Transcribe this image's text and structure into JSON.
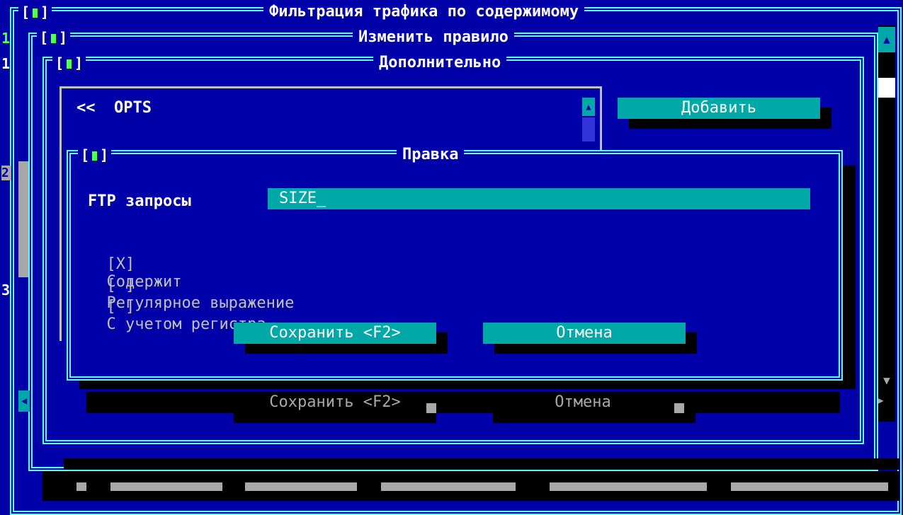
{
  "window_main": {
    "title": "Фильтрация трафика по содержимому"
  },
  "window_edit_rule": {
    "title": "Изменить правило",
    "line_numbers": [
      "1",
      "1"
    ]
  },
  "window_advanced": {
    "title": "Дополнительно",
    "list_item": "<<  OPTS",
    "add_button": "Добавить",
    "save_button": "Сохранить <F2>",
    "cancel_button": "Отмена"
  },
  "dialog_edit": {
    "title": "Правка",
    "field_label": "FTP запросы",
    "field_value": "SIZE_",
    "options": [
      {
        "mark": "[X]",
        "label": "Содержит"
      },
      {
        "mark": "[ ]",
        "label": "Регулярное выражение"
      },
      {
        "mark": "[ ]",
        "label": "С учетом регистра"
      }
    ],
    "save_button": "Сохранить <F2>",
    "cancel_button": "Отмена"
  },
  "left_scrollbar": {
    "markers": [
      "2",
      "3"
    ]
  },
  "close_box": "[▮]",
  "colors": {
    "background": "#0000a8",
    "frame": "#55ffff",
    "button": "#00a8a8",
    "shadow": "#000000",
    "accent": "#55ff55"
  }
}
